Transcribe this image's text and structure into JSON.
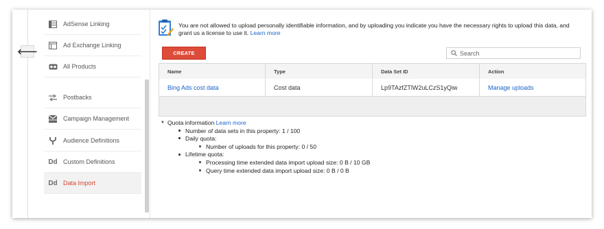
{
  "nav": {
    "items": [
      {
        "label": "AdSense Linking",
        "icon": "table-icon"
      },
      {
        "label": "Ad Exchange Linking",
        "icon": "layout-icon"
      },
      {
        "label": "All Products",
        "icon": "link-icon"
      },
      {
        "label": "Postbacks",
        "icon": "arrows-icon"
      },
      {
        "label": "Campaign Management",
        "icon": "envelope-icon"
      },
      {
        "label": "Audience Definitions",
        "icon": "fork-icon"
      },
      {
        "label": "Custom Definitions",
        "icon": "dd-icon"
      },
      {
        "label": "Data Import",
        "icon": "dd-icon",
        "active": true
      }
    ],
    "dd_glyph": "Dd",
    "back_glyph": "🡐"
  },
  "notice": {
    "text": "You are not allowed to upload personally identifiable information, and by uploading you indicate you have the necessary rights to upload this data, and grant us a license to use it.",
    "link": "Learn more"
  },
  "toolbar": {
    "create_label": "CREATE",
    "search_placeholder": "Search"
  },
  "table": {
    "headers": [
      "Name",
      "Type",
      "Data Set ID",
      "Action"
    ],
    "rows": [
      {
        "name": "Bing Ads cost data",
        "type": "Cost data",
        "id": "Lp9TAzfZTlW2uLCzS1yQiw",
        "action": "Manage uploads"
      }
    ]
  },
  "quota": {
    "title": "Quota information",
    "link": "Learn more",
    "datasets": "Number of data sets in this property: 1 / 100",
    "daily_label": "Daily quota:",
    "daily_uploads": "Number of uploads for this property: 0 / 50",
    "lifetime_label": "Lifetime quota:",
    "processing": "Processing time extended data import upload size: 0 B / 10 GB",
    "query": "Query time extended data import upload size: 0 B / 0 B"
  },
  "colors": {
    "accent": "#dd4b39",
    "link": "#1a64c8",
    "active_nav": "#d34836"
  }
}
